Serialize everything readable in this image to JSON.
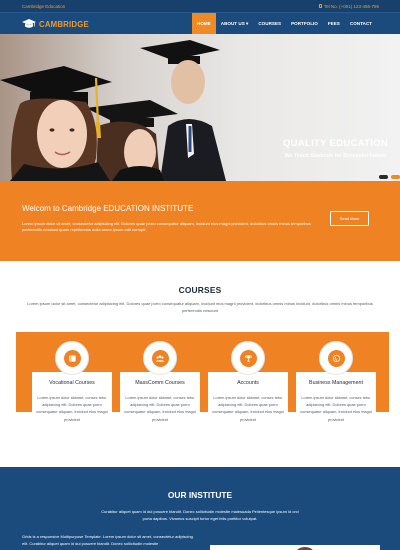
{
  "topbar": {
    "brand": "Cambridge Education",
    "phone": "Tel No. (+001) 123-456-789"
  },
  "header": {
    "logo_text": "CAMBRIDGE",
    "nav": [
      {
        "label": "HOME",
        "active": true
      },
      {
        "label": "ABOUT US ▾",
        "active": false
      },
      {
        "label": "COURSES",
        "active": false
      },
      {
        "label": "PORTFOLIO",
        "active": false
      },
      {
        "label": "FEES",
        "active": false
      },
      {
        "label": "CONTACT",
        "active": false
      }
    ]
  },
  "hero": {
    "title": "QUALITY EDUCATION",
    "subtitle": "We Teach Students for Sucessful Future"
  },
  "banner": {
    "title": "Welcom to Cambridge EDUCATION INSTITUTE",
    "text": "Lorem ipsum dolor sit amet, consectetur adipisicing elit. Dolores quae porro consequatur aliquam, incidunt eius magni provident, doloribus omnis minus temporibus perferendis nesciunt quam repellendus nulla nemo ipsum odit corrupti",
    "button": "Read More"
  },
  "courses": {
    "title": "COURSES",
    "description": "Lorem ipsum dolor sit amet, consectetur adipisicing elit. Dolores quae porro consequatur aliquam, incidunt eius magni provident, doloribus omnis minus incidunt, doloribus omnis minus temporibus perferendis nesciunt",
    "items": [
      {
        "icon": "book-icon",
        "title": "Vocational Courses",
        "text": "Lorem ipsum dolor sitamet, consec tetur adipisicing elit. Dolores quae porro consequatur aliquam, incidunt eius magni provident"
      },
      {
        "icon": "group-icon",
        "title": "MassComm Courses",
        "text": "Lorem ipsum dolor sitamet, consec tetur adipisicing elit. Dolores quae porro consequatur aliquam, incidunt eius magni provident"
      },
      {
        "icon": "trophy-icon",
        "title": "Accounts",
        "text": "Lorem ipsum dolor sitamet, consec tetur adipisicing elit. Dolores quae porro consequatur aliquam, incidunt eius magni provident"
      },
      {
        "icon": "globe-icon",
        "title": "Business Management",
        "text": "Lorem ipsum dolor sitamet, consec tetur adipisicing elit. Dolores quae porro consequatur aliquam, incidunt eius magni provident"
      }
    ]
  },
  "institute": {
    "title": "OUR INSTITUTE",
    "description": "Curabitur aliquet quam id dui posuere blandit. Donec sollicitudin molestie malesuada Pellentesque ipsum id orci porta dapibus. Vivamus suscipit tortor eget felis porttitor volutpat.",
    "text": "Grids is a responsive Multipurpose Template. Lorem ipsum dolor sit amet, consectetur adipiscing elit. Curabitur aliquet quam id dui posuere blandit. Donec sollicitudin molestie"
  },
  "colors": {
    "navy": "#1b4a7c",
    "orange": "#ef8223"
  }
}
